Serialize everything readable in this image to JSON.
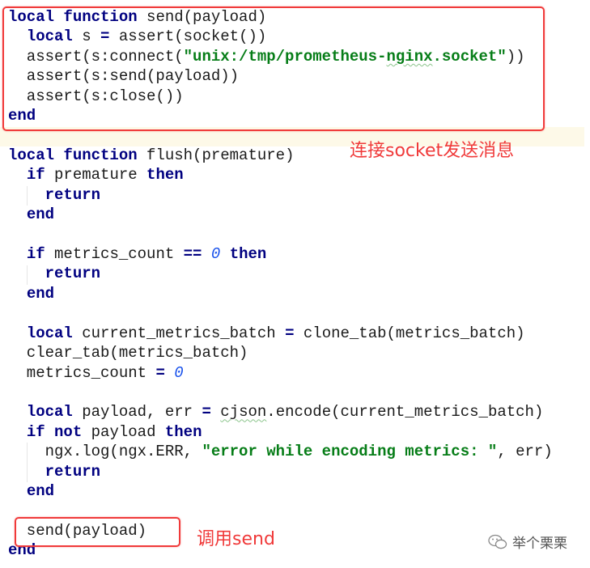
{
  "annotations": {
    "box1_label": "连接socket发送消息",
    "box2_label": "调用send",
    "color": "#f03a3a"
  },
  "watermark": {
    "icon": "wechat-icon",
    "text": "举个栗栗"
  },
  "code": {
    "language": "lua",
    "lines": [
      [
        [
          "local",
          "kw"
        ],
        [
          " ",
          "plain"
        ],
        [
          "function",
          "kw"
        ],
        [
          " send(payload)",
          "plain"
        ]
      ],
      [
        [
          "  ",
          "plain"
        ],
        [
          "local",
          "kw"
        ],
        [
          " s ",
          "plain"
        ],
        [
          "=",
          "op"
        ],
        [
          " assert(socket())",
          "plain"
        ]
      ],
      [
        [
          "  assert(s:connect(",
          "plain"
        ],
        [
          "\"unix:/tmp/prometheus-",
          "str"
        ],
        [
          "nginx",
          "str warn"
        ],
        [
          ".socket\"",
          "str"
        ],
        [
          "))",
          "plain"
        ]
      ],
      [
        [
          "  assert(s:send(payload))",
          "plain"
        ]
      ],
      [
        [
          "  assert(s:close())",
          "plain"
        ]
      ],
      [
        [
          "end",
          "kw"
        ]
      ],
      [],
      [
        [
          "local",
          "kw"
        ],
        [
          " ",
          "plain"
        ],
        [
          "function",
          "kw"
        ],
        [
          " flush(premature)",
          "plain"
        ]
      ],
      [
        [
          "  ",
          "plain"
        ],
        [
          "if",
          "kw"
        ],
        [
          " premature ",
          "plain"
        ],
        [
          "then",
          "kw"
        ]
      ],
      [
        [
          "    ",
          "plain"
        ],
        [
          "return",
          "kw"
        ]
      ],
      [
        [
          "  ",
          "plain"
        ],
        [
          "end",
          "kw"
        ]
      ],
      [],
      [
        [
          "  ",
          "plain"
        ],
        [
          "if",
          "kw"
        ],
        [
          " metrics_count ",
          "plain"
        ],
        [
          "==",
          "op"
        ],
        [
          " ",
          "plain"
        ],
        [
          "0",
          "num"
        ],
        [
          " ",
          "plain"
        ],
        [
          "then",
          "kw"
        ]
      ],
      [
        [
          "    ",
          "plain"
        ],
        [
          "return",
          "kw"
        ]
      ],
      [
        [
          "  ",
          "plain"
        ],
        [
          "end",
          "kw"
        ]
      ],
      [],
      [
        [
          "  ",
          "plain"
        ],
        [
          "local",
          "kw"
        ],
        [
          " current_metrics_batch ",
          "plain"
        ],
        [
          "=",
          "op"
        ],
        [
          " clone_tab(metrics_batch)",
          "plain"
        ]
      ],
      [
        [
          "  clear_tab(metrics_batch)",
          "plain"
        ]
      ],
      [
        [
          "  metrics_count ",
          "plain"
        ],
        [
          "=",
          "op"
        ],
        [
          " ",
          "plain"
        ],
        [
          "0",
          "num"
        ]
      ],
      [],
      [
        [
          "  ",
          "plain"
        ],
        [
          "local",
          "kw"
        ],
        [
          " payload, err ",
          "plain"
        ],
        [
          "=",
          "op"
        ],
        [
          " ",
          "plain"
        ],
        [
          "cjson",
          "plain warn"
        ],
        [
          ".encode(current_metrics_batch)",
          "plain"
        ]
      ],
      [
        [
          "  ",
          "plain"
        ],
        [
          "if",
          "kw"
        ],
        [
          " ",
          "plain"
        ],
        [
          "not",
          "kw"
        ],
        [
          " payload ",
          "plain"
        ],
        [
          "then",
          "kw"
        ]
      ],
      [
        [
          "    ngx.log(ngx.ERR, ",
          "plain"
        ],
        [
          "\"error while encoding metrics: \"",
          "str"
        ],
        [
          ", err)",
          "plain"
        ]
      ],
      [
        [
          "    ",
          "plain"
        ],
        [
          "return",
          "kw"
        ]
      ],
      [
        [
          "  ",
          "plain"
        ],
        [
          "end",
          "kw"
        ]
      ],
      [],
      [
        [
          "  send(payload)",
          "plain"
        ]
      ],
      [
        [
          "end",
          "kw"
        ]
      ]
    ]
  }
}
